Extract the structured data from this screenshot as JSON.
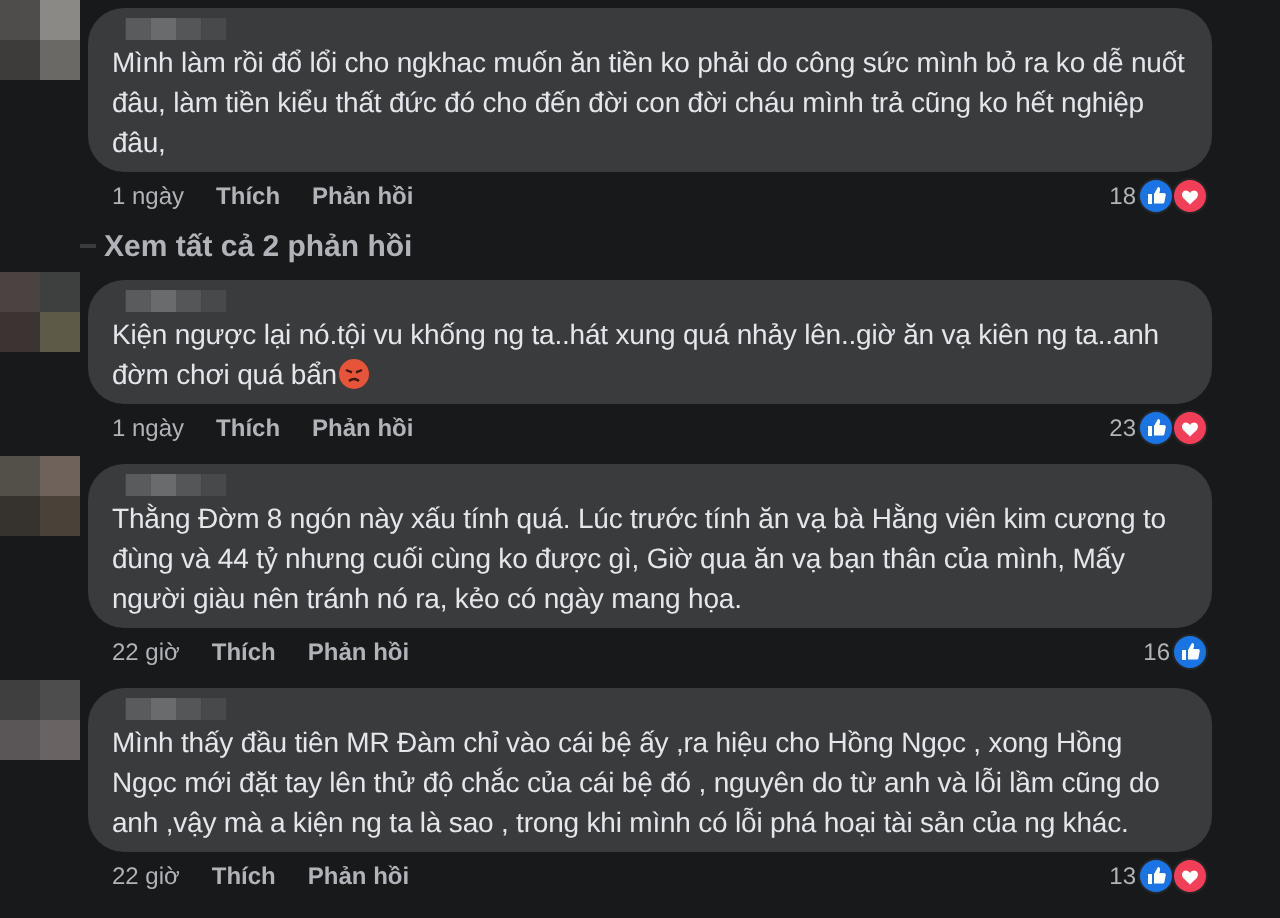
{
  "comments": [
    {
      "text": "Mình làm rồi đổ lổi cho ngkhac muốn ăn tiền ko phải do công sức mình bỏ ra ko dễ nuốt đâu, làm tiền kiểu thất đức đó cho đến đời con đời cháu mình trả cũng ko hết nghiệp đâu,",
      "time": "1 ngày",
      "like": "Thích",
      "reply": "Phản hồi",
      "count": "18",
      "liked": true,
      "loved": true,
      "view_replies": "Xem tất cả 2 phản hồi"
    },
    {
      "text": "Kiện ngược lại nó.tội vu khống ng ta..hát xung quá nhảy lên..giờ ăn vạ kiên ng ta..anh đờm chơi quá bẩn",
      "angry_emoji": true,
      "time": "1 ngày",
      "like": "Thích",
      "reply": "Phản hồi",
      "count": "23",
      "liked": true,
      "loved": true
    },
    {
      "text": "Thằng Đờm 8 ngón này xấu tính quá. Lúc trước tính ăn vạ bà Hằng viên kim cương to đùng và 44 tỷ nhưng cuối cùng ko được gì, Giờ qua ăn vạ bạn thân của mình, Mấy người giàu nên tránh nó ra, kẻo có ngày mang họa.",
      "time": "22 giờ",
      "like": "Thích",
      "reply": "Phản hồi",
      "count": "16",
      "liked": true,
      "loved": false
    },
    {
      "text": "Mình thấy đầu tiên MR Đàm chỉ vào cái bệ ấy ,ra hiệu cho Hồng Ngọc , xong Hồng Ngọc mới đặt tay lên thử độ chắc của cái bệ đó , nguyên do từ anh và lỗi lầm cũng do anh ,vậy mà a kiện ng ta là sao , trong khi mình có lỗi phá hoại tài sản của ng khác.",
      "time": "22 giờ",
      "like": "Thích",
      "reply": "Phản hồi",
      "count": "13",
      "liked": true,
      "loved": true
    }
  ]
}
